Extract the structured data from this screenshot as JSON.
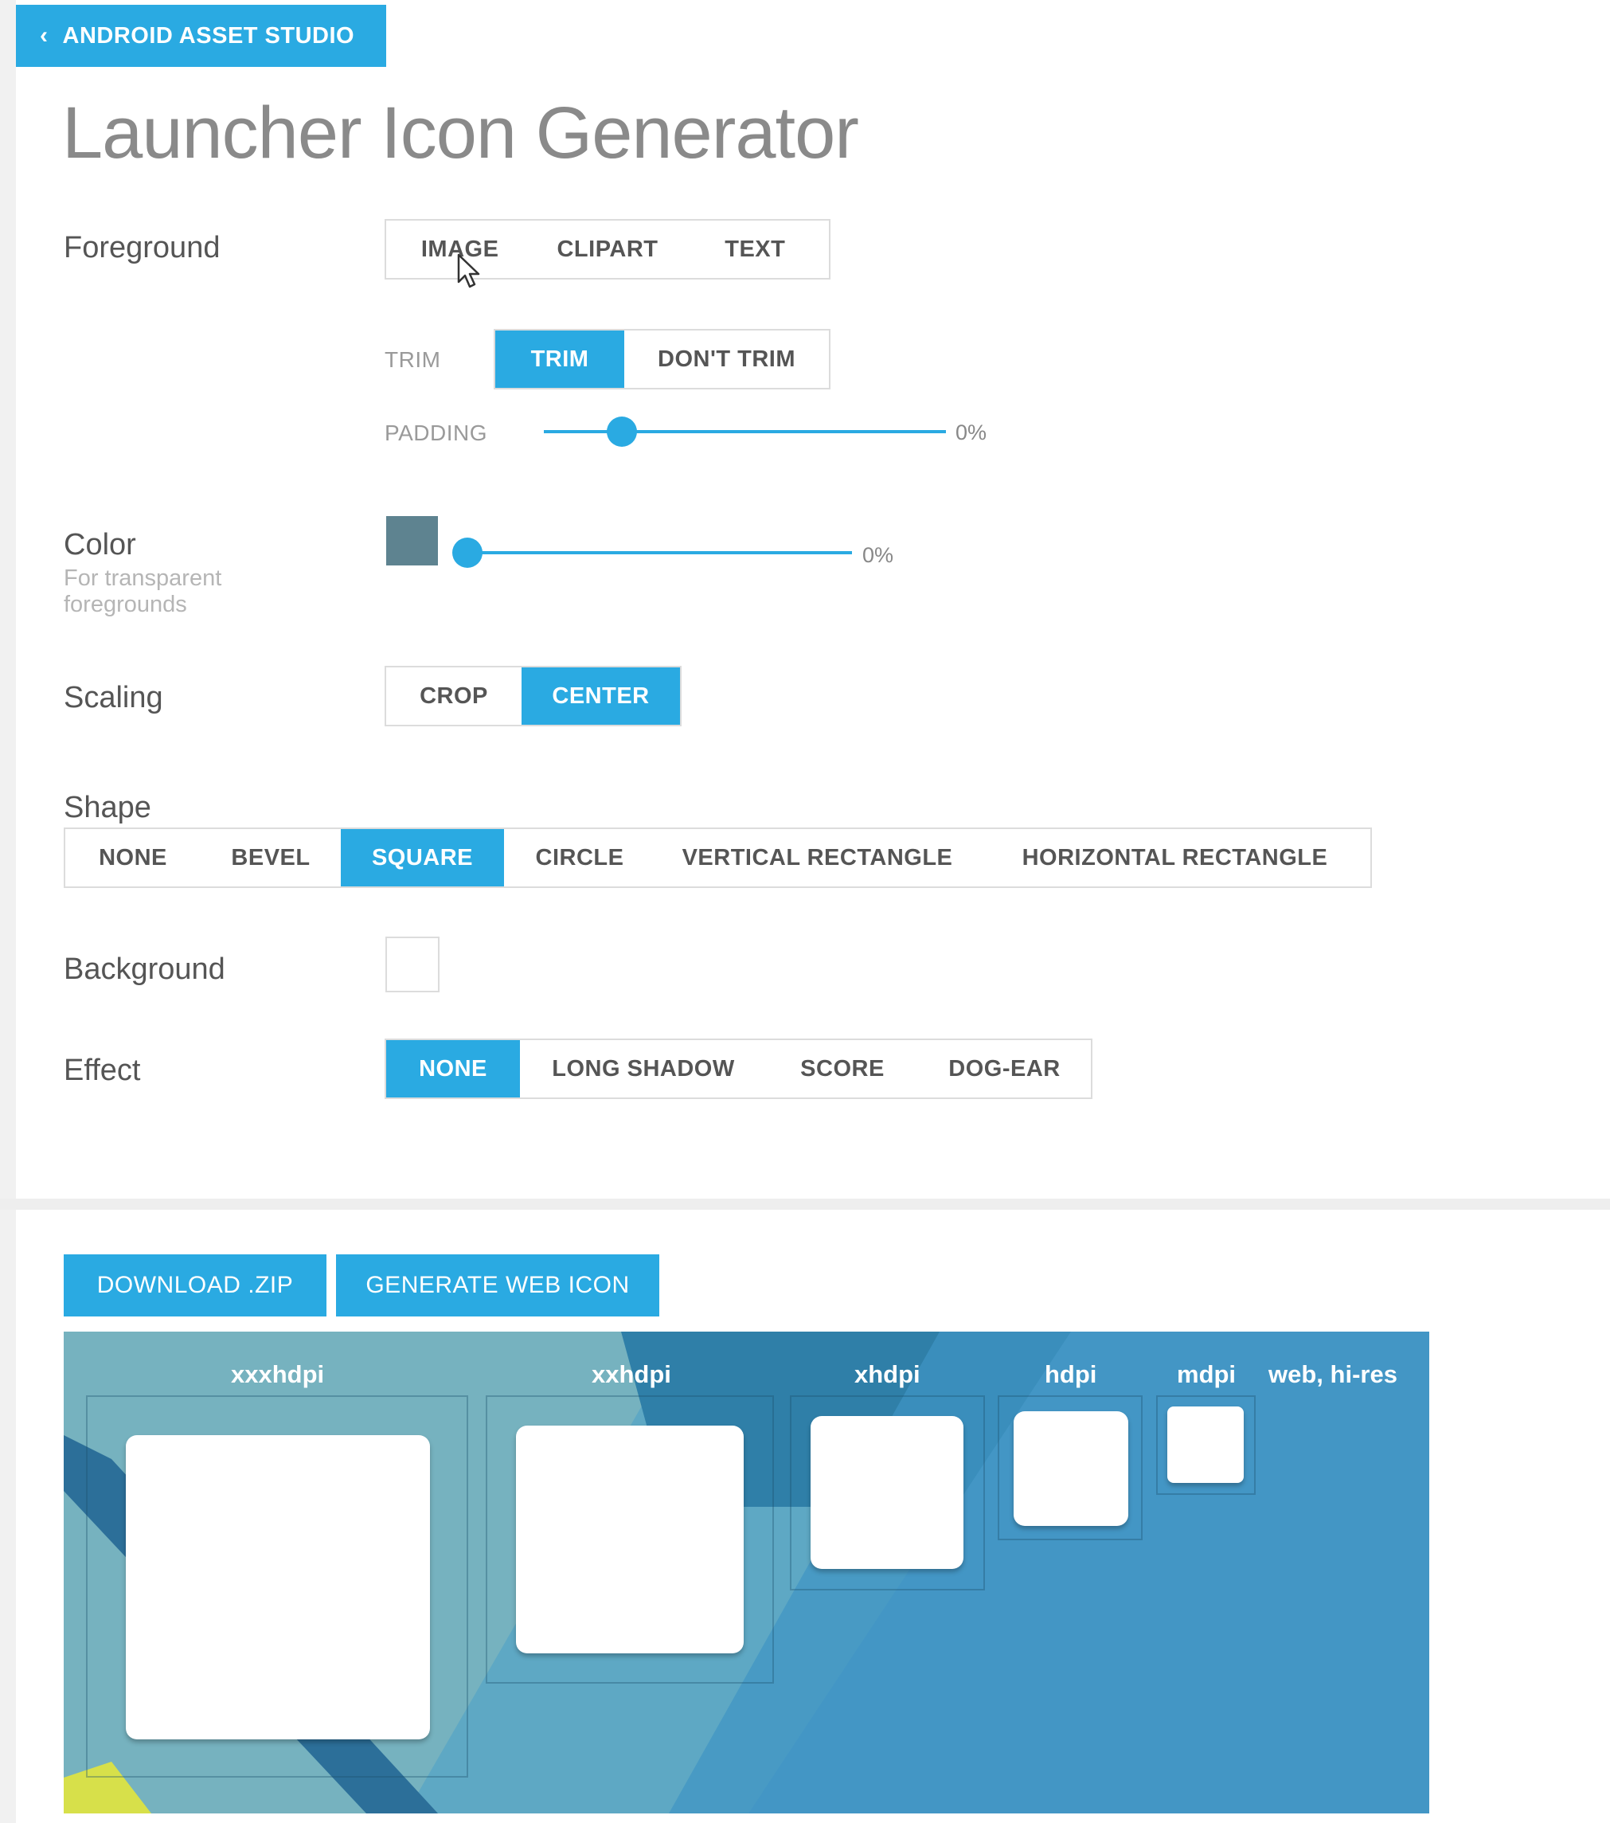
{
  "header": {
    "back_label": "ANDROID ASSET STUDIO"
  },
  "page_title": "Launcher Icon Generator",
  "foreground": {
    "label": "Foreground",
    "options": [
      "IMAGE",
      "CLIPART",
      "TEXT"
    ],
    "trim": {
      "label": "TRIM",
      "options": [
        "TRIM",
        "DON'T TRIM"
      ],
      "selected": "TRIM"
    },
    "padding": {
      "label": "PADDING",
      "value_text": "0%",
      "value": 0.2
    }
  },
  "color": {
    "label": "Color",
    "sublabel": "For transparent foregrounds",
    "swatch": "#5e8390",
    "value_text": "0%",
    "value": 0.0
  },
  "scaling": {
    "label": "Scaling",
    "options": [
      "CROP",
      "CENTER"
    ],
    "selected": "CENTER"
  },
  "shape": {
    "label": "Shape",
    "options": [
      "NONE",
      "BEVEL",
      "SQUARE",
      "CIRCLE",
      "VERTICAL RECTANGLE",
      "HORIZONTAL RECTANGLE"
    ],
    "selected": "SQUARE"
  },
  "background": {
    "label": "Background",
    "swatch": "#ffffff"
  },
  "effect": {
    "label": "Effect",
    "options": [
      "NONE",
      "LONG SHADOW",
      "SCORE",
      "DOG-EAR"
    ],
    "selected": "NONE"
  },
  "actions": {
    "download": "DOWNLOAD .ZIP",
    "web_icon": "GENERATE WEB ICON"
  },
  "preview": {
    "densities": [
      "xxxhdpi",
      "xxhdpi",
      "xhdpi",
      "hdpi",
      "mdpi",
      "web, hi-res"
    ]
  },
  "colors": {
    "accent": "#2aaae2"
  }
}
